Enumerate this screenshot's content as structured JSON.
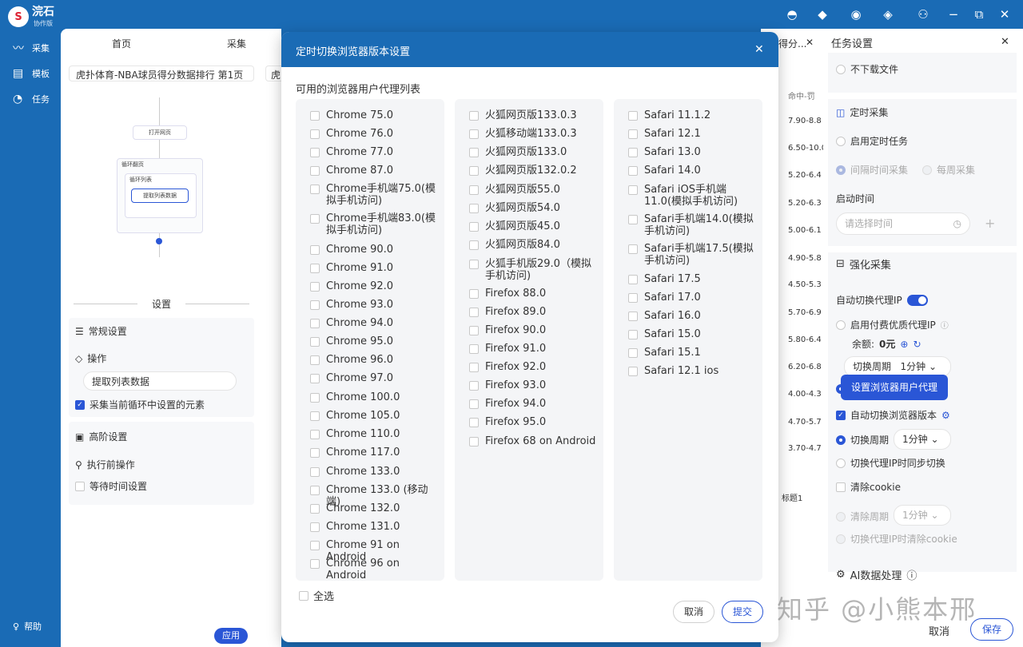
{
  "app": {
    "name": "浣石",
    "edition": "协作版"
  },
  "nav": [
    {
      "label": "采集",
      "icon": "collect-icon"
    },
    {
      "label": "模板",
      "icon": "template-icon"
    },
    {
      "label": "任务",
      "icon": "task-icon"
    }
  ],
  "help": "帮助",
  "tabs": [
    "首页",
    "采集",
    "得分...",
    "虎"
  ],
  "page_title": "虎扑体育-NBA球员得分数据排行 第1页",
  "flow": {
    "open": "打开网页",
    "loop_page": "循环翻页",
    "loop_list": "循环列表",
    "extract": "提取列表数据"
  },
  "settings": {
    "title": "设置",
    "general": "常规设置",
    "operation": "操作",
    "op_value": "提取列表数据",
    "collect_current": "采集当前循环中设置的元素",
    "advanced": "高阶设置",
    "pre_action": "执行前操作",
    "wait": "等待时间设置",
    "apply": "应用"
  },
  "dialog": {
    "title": "定时切换浏览器版本设置",
    "subtitle": "可用的浏览器用户代理列表",
    "col1": [
      "Chrome 75.0",
      "Chrome 76.0",
      "Chrome 77.0",
      "Chrome 87.0",
      "Chrome手机端75.0(模拟手机访问)",
      "Chrome手机端83.0(模拟手机访问)",
      "Chrome 90.0",
      "Chrome 91.0",
      "Chrome 92.0",
      "Chrome 93.0",
      "Chrome 94.0",
      "Chrome 95.0",
      "Chrome 96.0",
      "Chrome 97.0",
      "Chrome 100.0",
      "Chrome 105.0",
      "Chrome 110.0",
      "Chrome 117.0",
      "Chrome 133.0",
      "Chrome 133.0 (移动端)",
      "Chrome 132.0",
      "Chrome 131.0",
      "Chrome 91 on Android",
      "Chrome 96 on Android"
    ],
    "col2": [
      "火狐网页版133.0.3",
      "火狐移动端133.0.3",
      "火狐网页版133.0",
      "火狐网页版132.0.2",
      "火狐网页版55.0",
      "火狐网页版54.0",
      "火狐网页版45.0",
      "火狐网页版84.0",
      "火狐手机版29.0（模拟手机访问)",
      "Firefox 88.0",
      "Firefox 89.0",
      "Firefox 90.0",
      "Firefox 91.0",
      "Firefox 92.0",
      "Firefox 93.0",
      "Firefox 94.0",
      "Firefox 95.0",
      "Firefox 68 on Android"
    ],
    "col3": [
      "Safari 11.1.2",
      "Safari 12.1",
      "Safari 13.0",
      "Safari 14.0",
      "Safari iOS手机端11.0(模拟手机访问)",
      "Safari手机端14.0(模拟手机访问)",
      "Safari手机端17.5(模拟手机访问)",
      "Safari 17.5",
      "Safari 17.0",
      "Safari 16.0",
      "Safari 15.0",
      "Safari 15.1",
      "Safari 12.1 ios"
    ],
    "select_all": "全选",
    "cancel": "取消",
    "submit": "提交"
  },
  "table": {
    "header": "命中-罚",
    "rows": [
      "7.90-8.8",
      "6.50-10.0",
      "5.20-6.4",
      "5.20-6.3",
      "5.00-6.1",
      "4.90-5.8",
      "4.50-5.3",
      "5.70-6.9",
      "5.80-6.4",
      "6.20-6.8",
      "4.00-4.3",
      "4.70-5.7",
      "3.70-4.7"
    ],
    "footer": "标题1"
  },
  "task": {
    "title": "任务设置",
    "no_download": "不下载文件",
    "schedule": "定时采集",
    "enable_schedule": "启用定时任务",
    "interval": "间隔时间采集",
    "weekly": "每周采集",
    "start_time": "启动时间",
    "time_placeholder": "请选择时间",
    "enhance": "强化采集",
    "auto_proxy": "自动切换代理IP",
    "paid_proxy": "启用付费优质代理IP",
    "balance_label": "余额:",
    "balance_value": "0元",
    "period": "切换周期",
    "period_value": "1分钟",
    "tooltip": "设置浏览器用户代理",
    "auto_browser": "自动切换浏览器版本",
    "sync_switch": "切换代理IP时同步切换",
    "clear_cookie": "清除cookie",
    "clear_period": "清除周期",
    "clear_on_switch": "切换代理IP时清除cookie",
    "ai": "AI数据处理",
    "cancel": "取消",
    "save": "保存"
  },
  "watermark": "知乎 @小熊本邢"
}
